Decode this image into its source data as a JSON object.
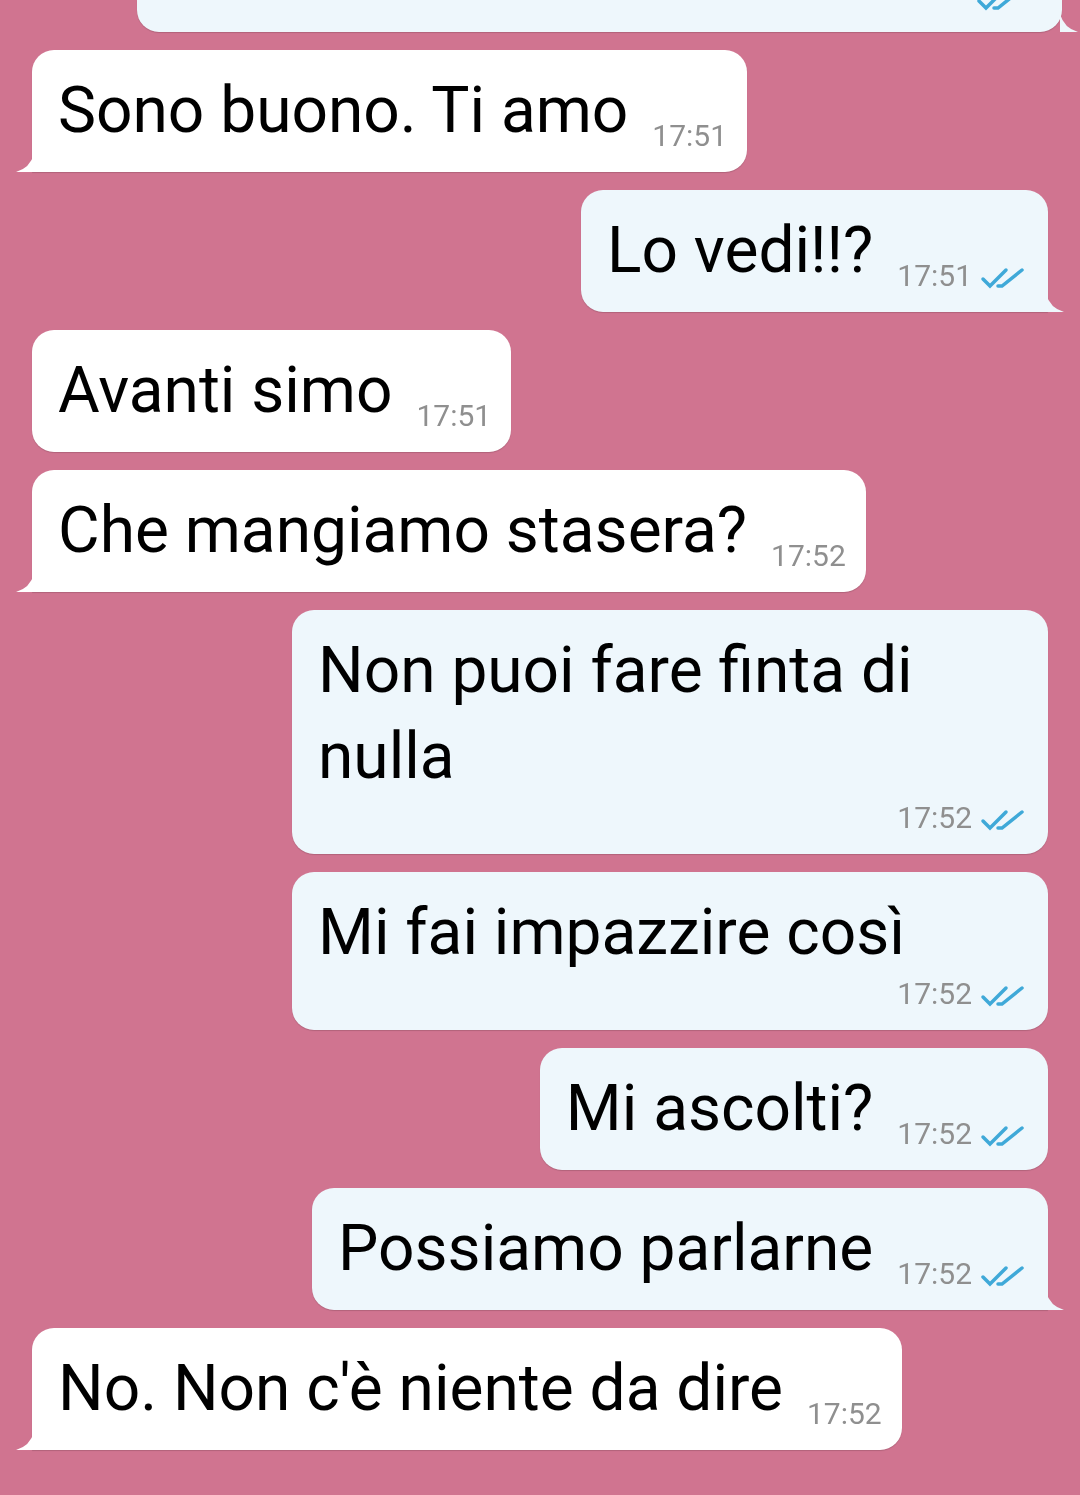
{
  "messages": [
    {
      "kind": "outgoing_cut",
      "tail": true,
      "read": true
    },
    {
      "kind": "incoming",
      "tail": true,
      "text": "Sono buono. Ti amo",
      "time": "17:51"
    },
    {
      "kind": "outgoing",
      "tail": true,
      "read": true,
      "text": "Lo vedi!!?",
      "time": "17:51"
    },
    {
      "kind": "incoming",
      "tail": false,
      "text": "Avanti simo",
      "time": "17:51"
    },
    {
      "kind": "incoming",
      "tail": true,
      "text": "Che mangiamo stasera?",
      "time": "17:52"
    },
    {
      "kind": "outgoing",
      "tail": false,
      "read": true,
      "text": "Non puoi fare finta di nulla",
      "time": "17:52"
    },
    {
      "kind": "outgoing",
      "tail": false,
      "read": true,
      "text": "Mi fai impazzire così",
      "time": "17:52"
    },
    {
      "kind": "outgoing",
      "tail": false,
      "read": true,
      "text": "Mi ascolti?",
      "time": "17:52"
    },
    {
      "kind": "outgoing",
      "tail": true,
      "read": true,
      "text": "Possiamo parlarne",
      "time": "17:52"
    },
    {
      "kind": "incoming",
      "tail": true,
      "text": "No. Non c'è niente da dire",
      "time": "17:52"
    }
  ]
}
